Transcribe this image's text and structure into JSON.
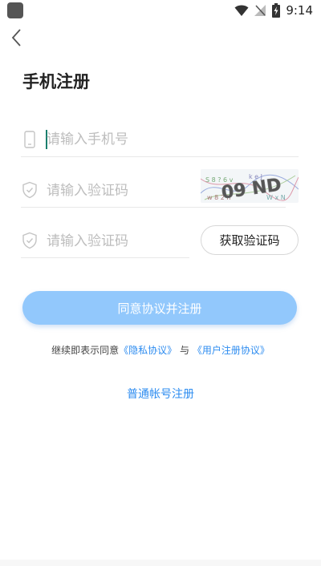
{
  "status_bar": {
    "time": "9:14"
  },
  "header": {
    "title": "手机注册"
  },
  "form": {
    "phone": {
      "placeholder": "请输入手机号",
      "value": ""
    },
    "captcha": {
      "placeholder": "请输入验证码",
      "value": "",
      "image_text": "09 ND"
    },
    "sms_code": {
      "placeholder": "请输入验证码",
      "value": ""
    },
    "sms_button_label": "获取验证码",
    "submit_label": "同意协议并注册"
  },
  "agreement": {
    "prefix": "继续即表示同意",
    "privacy_link": "《隐私协议》",
    "conjunction": "与",
    "user_link": "《用户注册协议》"
  },
  "alt_register": {
    "label": "普通帐号注册"
  },
  "colors": {
    "accent": "#2d8cf0",
    "button_bg": "#92c8fc"
  }
}
